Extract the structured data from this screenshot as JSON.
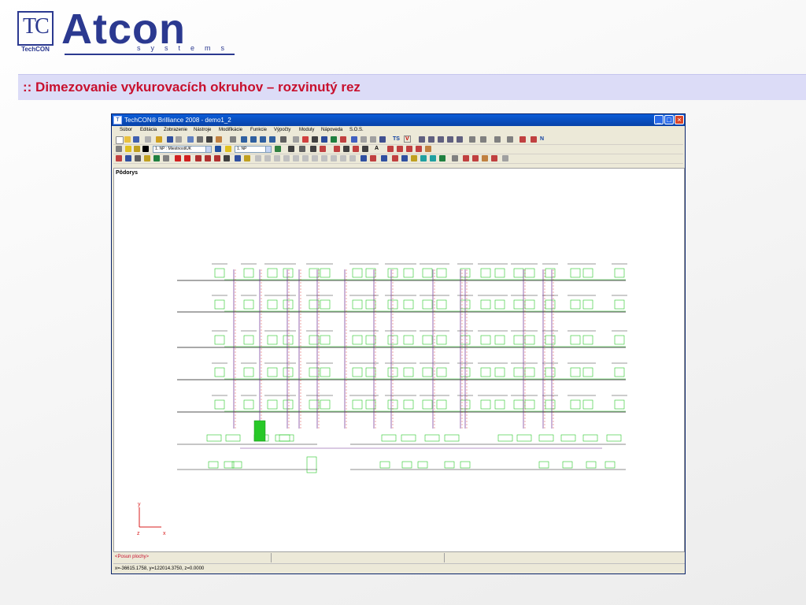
{
  "logo": {
    "tc_mark": "TC",
    "tc_caption": "TechCON",
    "name": "Atcon",
    "tagline": "systems"
  },
  "slide_title": ":: Dimezovanie vykurovacích okruhov – rozvinutý rez",
  "window": {
    "title": "TechCON® Brilliance 2008   - demo1_2",
    "controls": {
      "minimize": "_",
      "maximize": "□",
      "close": "×"
    }
  },
  "menu": {
    "items": [
      "Súbor",
      "Editácia",
      "Zobrazenie",
      "Nástroje",
      "Modifikácie",
      "Funkcie",
      "Výpočty",
      "Moduly",
      "Nápoveda",
      "S.O.S."
    ]
  },
  "toolbar": {
    "ts_label": "TS",
    "v_label": "V",
    "n_label": "N",
    "floor_select": "1. NP : MiestnostiUK",
    "np_select": "1. NP",
    "text_tool": "A"
  },
  "canvas": {
    "view_label": "Pôdorys",
    "axis_y": "y",
    "axis_z": "z",
    "axis_x": "x"
  },
  "status": {
    "mode": "<Posun plochy>",
    "coords": "x=-36615.1758, y=122014.3750, z=0.0000"
  },
  "colors": {
    "brand": "#2b3990",
    "title_red": "#c8102e",
    "title_band": "#dcdcf7",
    "radiator_green": "#27c827",
    "riser_purple": "#6b2c8f",
    "riser_red": "#d81e1e",
    "floor_line": "#1a1a1a",
    "window_blue": "#0842a8"
  }
}
